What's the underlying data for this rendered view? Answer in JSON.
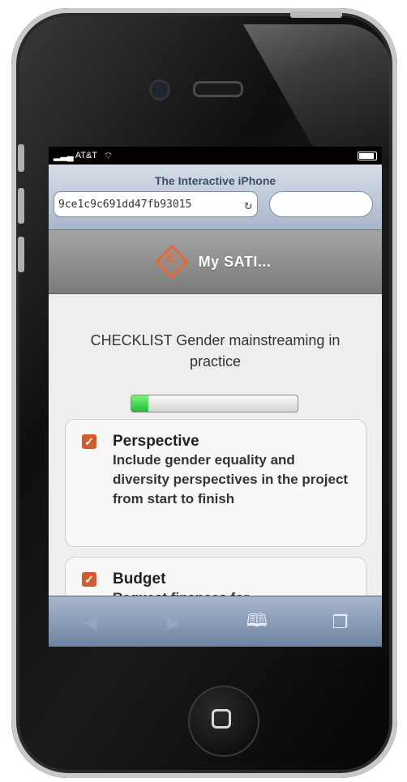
{
  "status_bar": {
    "carrier": "AT&T",
    "wifi_icon": "wifi-icon",
    "battery_icon": "battery-icon"
  },
  "browser": {
    "page_title": "The Interactive iPhone",
    "url": "9ce1c9c691dd47fb93015",
    "search_placeholder": ""
  },
  "app": {
    "title": "My SATI...",
    "logo_letter": "S",
    "accent": "#e36a3a"
  },
  "checklist": {
    "title": "CHECKLIST Gender mainstreaming in practice",
    "progress_percent": 10,
    "items": [
      {
        "title": "Perspective",
        "description": "Include gender equality and diversity perspectives in the project from start to finish",
        "checked": true
      },
      {
        "title": "Budget",
        "description": "Request finances for",
        "checked": true
      }
    ]
  },
  "toolbar": {
    "back": "◀",
    "forward": "▶",
    "bookmarks": "🕮",
    "pages": "❐"
  }
}
